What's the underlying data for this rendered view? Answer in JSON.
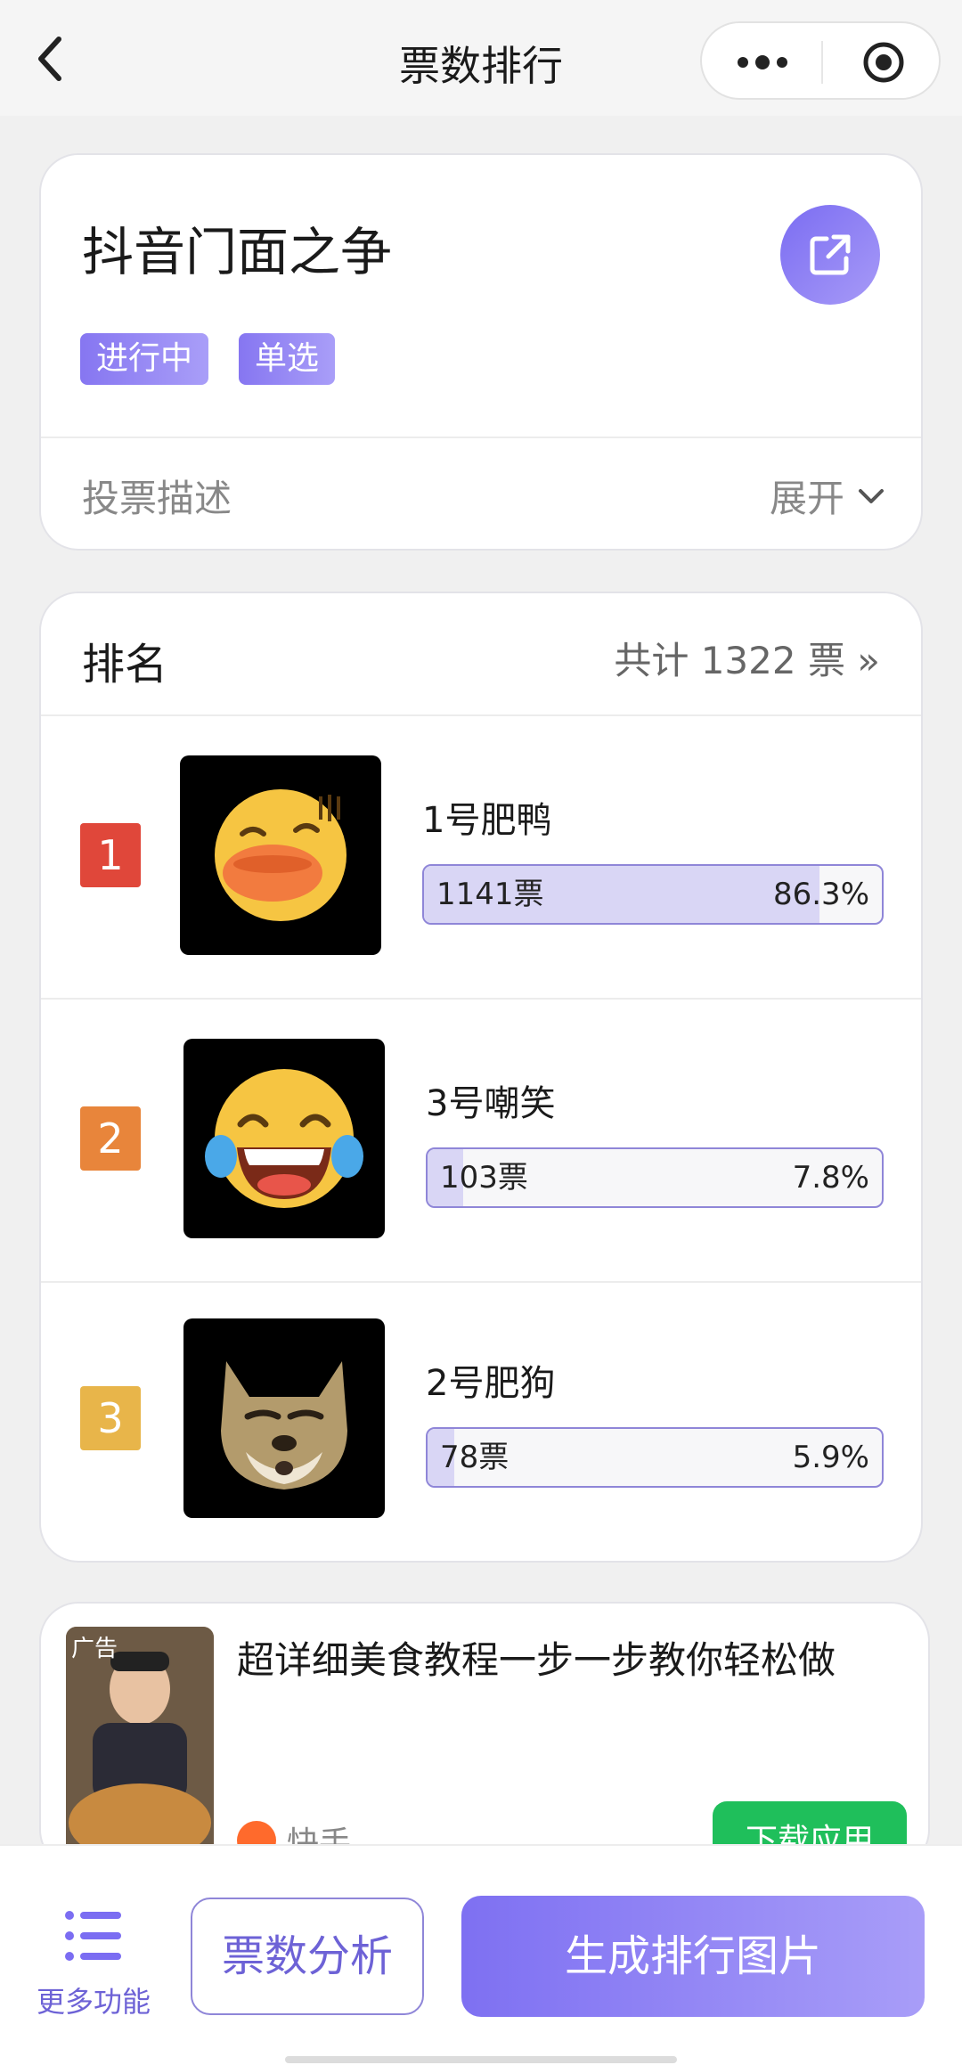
{
  "nav": {
    "title": "票数排行"
  },
  "vote": {
    "title": "抖音门面之争",
    "tags": [
      "进行中",
      "单选"
    ],
    "description_label": "投票描述",
    "expand_label": "展开"
  },
  "ranking": {
    "title": "排名",
    "total": "共计 1322 票 »",
    "rows": [
      {
        "rank": "1",
        "name": "1号肥鸭",
        "votes": "1141票",
        "percent": "86.3%",
        "fraction": 0.863,
        "badge_color": "#e0473a"
      },
      {
        "rank": "2",
        "name": "3号嘲笑",
        "votes": "103票",
        "percent": "7.8%",
        "fraction": 0.078,
        "badge_color": "#e8853b"
      },
      {
        "rank": "3",
        "name": "2号肥狗",
        "votes": "78票",
        "percent": "5.9%",
        "fraction": 0.059,
        "badge_color": "#e8b54a"
      }
    ]
  },
  "ad": {
    "tag": "广告",
    "title": "超详细美食教程一步一步教你轻松做",
    "brand": "快手",
    "button": "下载应用"
  },
  "bottom": {
    "more_label": "更多功能",
    "analysis_label": "票数分析",
    "generate_label": "生成排行图片"
  }
}
